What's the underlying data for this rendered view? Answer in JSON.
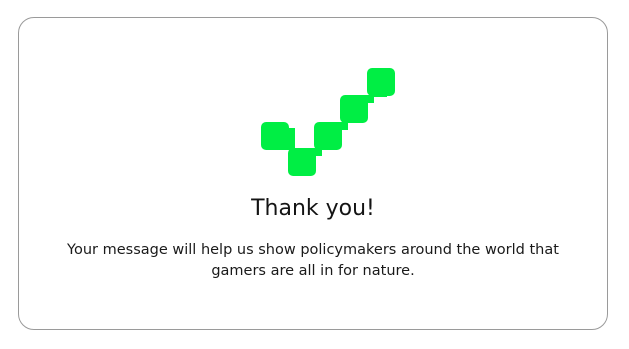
{
  "confirmation": {
    "icon": "checkmark-icon",
    "accent_color": "#00ee44",
    "title": "Thank you!",
    "message": "Your message will help us show policymakers around the world that gamers are all in for nature."
  }
}
